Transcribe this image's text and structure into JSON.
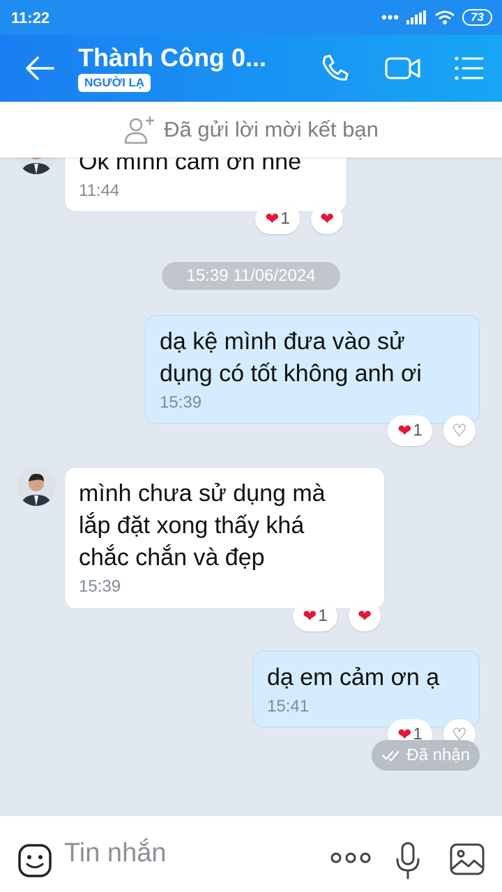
{
  "status_bar": {
    "time": "11:22",
    "battery": "73"
  },
  "header": {
    "title": "Thành Công 0...",
    "tag": "NGƯỜI LẠ"
  },
  "friend_request": {
    "text": "Đã gửi lời mời kết bạn"
  },
  "messages": [
    {
      "direction": "incoming",
      "text": "Ok mình cảm ơn nhé",
      "time": "11:44",
      "reaction_count": "1"
    },
    {
      "direction": "outgoing",
      "text": "dạ kệ mình đưa vào sử\ndụng có tốt không anh ơi",
      "time": "15:39",
      "reaction_count": "1"
    },
    {
      "direction": "incoming",
      "text": "mình chưa sử dụng mà\nlắp đặt xong thấy khá\nchắc chắn và đẹp",
      "time": "15:39",
      "reaction_count": "1"
    },
    {
      "direction": "outgoing",
      "text": "dạ em cảm ơn ạ",
      "time": "15:41",
      "reaction_count": "1"
    }
  ],
  "date_separator": "15:39 11/06/2024",
  "delivery_status": "Đã nhận",
  "composer": {
    "placeholder": "Tin nhắn"
  },
  "colors": {
    "header": "#1a7ef2",
    "outgoing_bubble": "#d4ecfd",
    "incoming_bubble": "#ffffff",
    "heart": "#e8163a",
    "background": "#e2e8f0"
  }
}
